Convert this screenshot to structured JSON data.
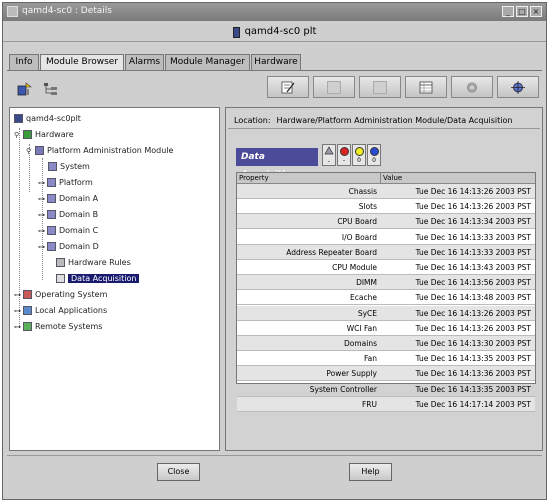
{
  "window": {
    "title": "qamd4-sc0 : Details",
    "app_title": "qamd4-sc0 plt"
  },
  "tabs": [
    {
      "label": "Info",
      "active": false
    },
    {
      "label": "Module Browser",
      "active": true
    },
    {
      "label": "Alarms",
      "active": false
    },
    {
      "label": "Module Manager",
      "active": false
    },
    {
      "label": "Hardware",
      "active": false
    }
  ],
  "tree": {
    "root": "qamd4-sc0plt",
    "hardware": "Hardware",
    "pam": "Platform Administration Module",
    "system": "System",
    "platform": "Platform",
    "domain_a": "Domain A",
    "domain_b": "Domain B",
    "domain_c": "Domain C",
    "domain_d": "Domain D",
    "hardware_rules": "Hardware Rules",
    "data_acquisition": "Data Acquisition",
    "operating_system": "Operating System",
    "local_applications": "Local Applications",
    "remote_systems": "Remote Systems"
  },
  "location": {
    "label": "Location:",
    "path": "Hardware/Platform Administration Module/Data Acquisition"
  },
  "module_title": "Data Acquisition",
  "alarm_counts": [
    "-",
    "0",
    "0"
  ],
  "table": {
    "headers": [
      "Property",
      "Value"
    ],
    "rows": [
      {
        "property": "Chassis",
        "value": "Tue Dec 16 14:13:26 2003 PST"
      },
      {
        "property": "Slots",
        "value": "Tue Dec 16 14:13:26 2003 PST"
      },
      {
        "property": "CPU Board",
        "value": "Tue Dec 16 14:13:34 2003 PST"
      },
      {
        "property": "I/O Board",
        "value": "Tue Dec 16 14:13:33 2003 PST"
      },
      {
        "property": "Address Repeater Board",
        "value": "Tue Dec 16 14:13:33 2003 PST"
      },
      {
        "property": "CPU Module",
        "value": "Tue Dec 16 14:13:43 2003 PST"
      },
      {
        "property": "DIMM",
        "value": "Tue Dec 16 14:13:56 2003 PST"
      },
      {
        "property": "Ecache",
        "value": "Tue Dec 16 14:13:48 2003 PST"
      },
      {
        "property": "SyCE",
        "value": "Tue Dec 16 14:13:26 2003 PST"
      },
      {
        "property": "WCI Fan",
        "value": "Tue Dec 16 14:13:26 2003 PST"
      },
      {
        "property": "Domains",
        "value": "Tue Dec 16 14:13:30 2003 PST"
      },
      {
        "property": "Fan",
        "value": "Tue Dec 16 14:13:35 2003 PST"
      },
      {
        "property": "Power Supply",
        "value": "Tue Dec 16 14:13:36 2003 PST"
      },
      {
        "property": "System Controller",
        "value": "Tue Dec 16 14:13:35 2003 PST"
      },
      {
        "property": "FRU",
        "value": "Tue Dec 16 14:17:14 2003 PST"
      }
    ]
  },
  "buttons": {
    "close": "Close",
    "help": "Help"
  }
}
